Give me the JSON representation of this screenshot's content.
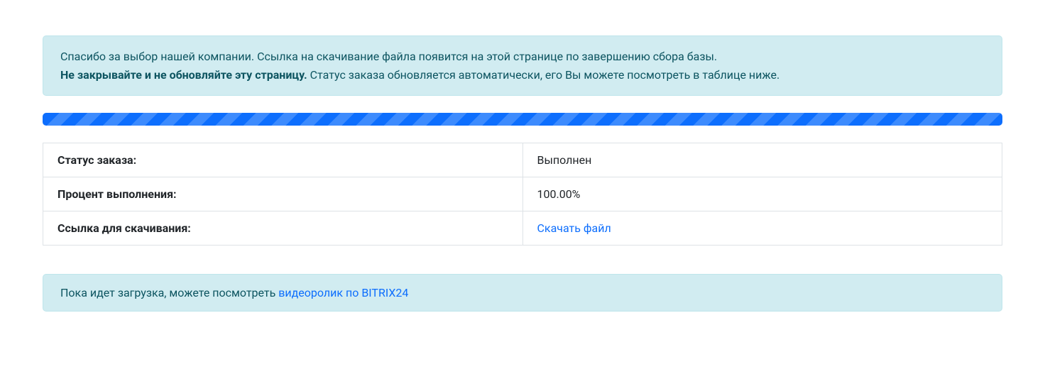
{
  "notice": {
    "line1": "Спасибо за выбор нашей компании. Ссылка на скачивание файла появится на этой странице по завершению сбора базы.",
    "strong": "Не закрывайте и не обновляйте эту страницу.",
    "line2_rest": " Статус заказа обновляется автоматически, его Вы можете посмотреть в таблице ниже."
  },
  "table": {
    "rows": [
      {
        "label": "Статус заказа:",
        "value": "Выполнен",
        "is_link": false
      },
      {
        "label": "Процент выполнения:",
        "value": "100.00%",
        "is_link": false
      },
      {
        "label": "Ссылка для скачивания:",
        "value": "Скачать файл",
        "is_link": true
      }
    ]
  },
  "bottom": {
    "prefix": "Пока идет загрузка, можете посмотреть ",
    "link": "видеоролик по BITRIX24"
  }
}
